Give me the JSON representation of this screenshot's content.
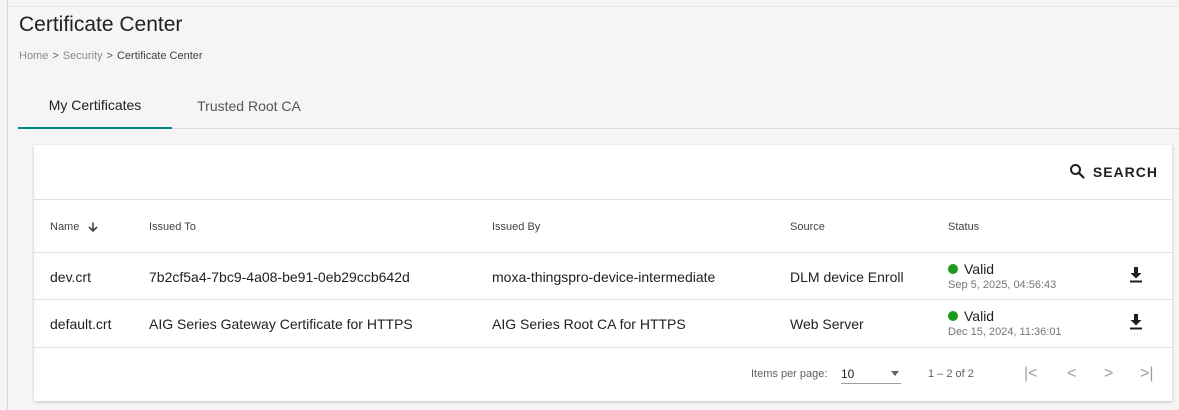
{
  "page": {
    "title": "Certificate Center",
    "breadcrumb": [
      "Home",
      "Security",
      "Certificate Center"
    ],
    "breadcrumb_separator": ">"
  },
  "tabs": [
    {
      "label": "My Certificates",
      "active": true
    },
    {
      "label": "Trusted Root CA",
      "active": false
    }
  ],
  "search": {
    "label": "SEARCH",
    "icon": "search-icon"
  },
  "table": {
    "columns": [
      "Name",
      "Issued To",
      "Issued By",
      "Source",
      "Status"
    ],
    "sort_icon": "arrow-down-icon",
    "rows": [
      {
        "name": "dev.crt",
        "issued_to": "7b2cf5a4-7bc9-4a08-be91-0eb29ccb642d",
        "issued_by": "moxa-thingspro-device-intermediate",
        "source": "DLM device Enroll",
        "status": "Valid",
        "status_date": "Sep 5, 2025, 04:56:43",
        "action_icon": "download-icon"
      },
      {
        "name": "default.crt",
        "issued_to": "AIG Series Gateway Certificate for HTTPS",
        "issued_by": "AIG Series Root CA for HTTPS",
        "source": "Web Server",
        "status": "Valid",
        "status_date": "Dec 15, 2024, 11:36:01",
        "action_icon": "download-icon"
      }
    ]
  },
  "pagination": {
    "items_per_page_label": "Items per page:",
    "items_per_page_value": "10",
    "range_label": "1 – 2 of 2",
    "first": "|<",
    "prev": "<",
    "next": ">",
    "last": ">|"
  },
  "colors": {
    "accent": "#008787",
    "valid_status": "#1b9a1b"
  }
}
